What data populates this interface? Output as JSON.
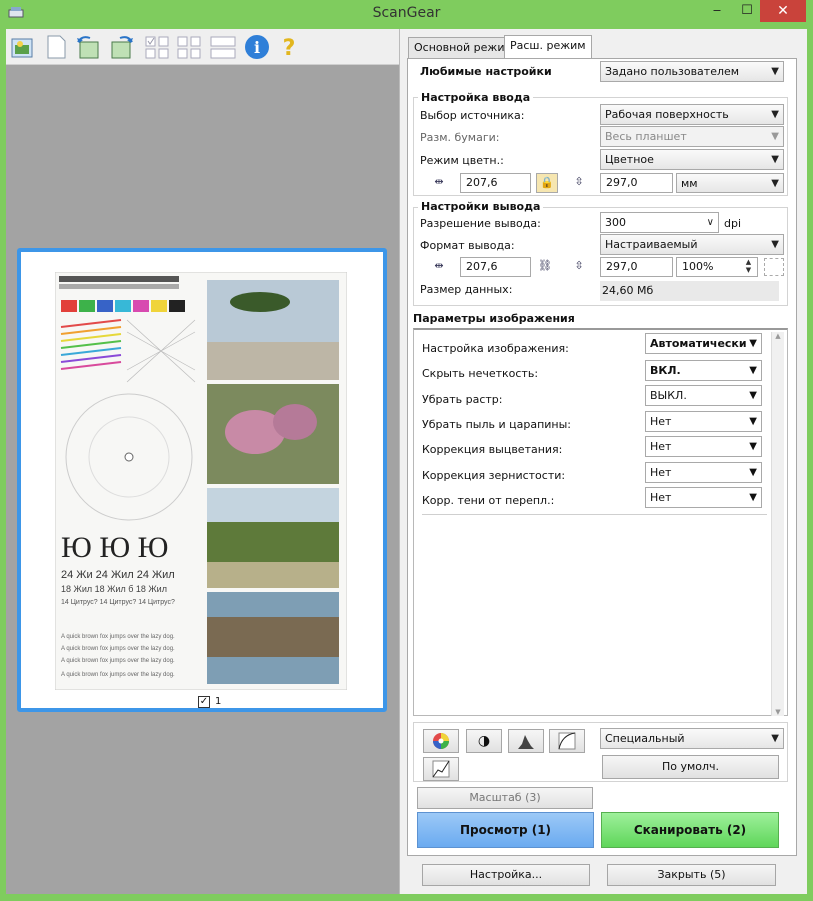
{
  "window": {
    "title": "ScanGear"
  },
  "toolbar": {
    "icons": [
      "scan-to-file-icon",
      "blank-page-icon",
      "rotate-left-icon",
      "rotate-right-icon",
      "checkbox-grid-icon",
      "thumbnail-grid-icon",
      "multi-crop-icon",
      "info-icon",
      "help-icon"
    ]
  },
  "preview": {
    "page_number": "1",
    "thumbnail_checked": true
  },
  "tabs": [
    {
      "label": "Основной режим"
    },
    {
      "label": "Расш. режим"
    }
  ],
  "favorites": {
    "label": "Любимые настройки",
    "value": "Задано пользователем"
  },
  "input_settings": {
    "title": "Настройка ввода",
    "source": {
      "label": "Выбор источника:",
      "value": "Рабочая поверхность"
    },
    "paper": {
      "label": "Разм. бумаги:",
      "value": "Весь планшет"
    },
    "color": {
      "label": "Режим цветн.:",
      "value": "Цветное"
    },
    "width": "207,6",
    "height": "297,0",
    "unit": "мм"
  },
  "output_settings": {
    "title": "Настройки вывода",
    "resolution": {
      "label": "Разрешение вывода:",
      "value": "300",
      "unit": "dpi"
    },
    "format": {
      "label": "Формат вывода:",
      "value": "Настраиваемый"
    },
    "width": "207,6",
    "height": "297,0",
    "scale": "100%",
    "data_size": {
      "label": "Размер данных:",
      "value": "24,60 Мб"
    }
  },
  "image_params": {
    "title": "Параметры изображения",
    "rows": [
      {
        "label": "Настройка изображения:",
        "value": "Автоматически",
        "bold": true
      },
      {
        "label": "Скрыть нечеткость:",
        "value": "ВКЛ.",
        "bold": true
      },
      {
        "label": "Убрать растр:",
        "value": "ВЫКЛ.",
        "bold": false
      },
      {
        "label": "Убрать пыль и царапины:",
        "value": "Нет",
        "bold": false
      },
      {
        "label": "Коррекция выцветания:",
        "value": "Нет",
        "bold": false
      },
      {
        "label": "Коррекция зернистости:",
        "value": "Нет",
        "bold": false
      },
      {
        "label": "Корр. тени от перепл.:",
        "value": "Нет",
        "bold": false
      }
    ]
  },
  "adjust": {
    "preset": "Специальный",
    "default_button": "По умолч.",
    "icons": [
      "color-wheel-icon",
      "brightness-contrast-icon",
      "histogram-icon",
      "tone-curve-icon",
      "final-review-icon"
    ]
  },
  "buttons": {
    "zoom": "Масштаб (3)",
    "preview": "Просмотр (1)",
    "scan": "Сканировать (2)",
    "settings": "Настройка...",
    "close": "Закрыть (5)"
  },
  "colors": {
    "accent": "#3d96e8",
    "titlebar": "#7fcc5e",
    "preview_btn": "#6aaaf0",
    "scan_btn": "#5fd65a"
  }
}
